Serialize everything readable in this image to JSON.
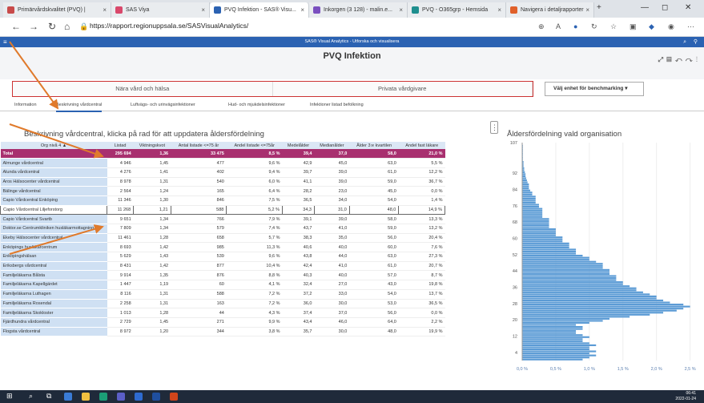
{
  "browser": {
    "tabs": [
      {
        "label": "Primärvårdskvalitet (PVQ) | ",
        "color": "#c84a4a"
      },
      {
        "label": "SAS Viya",
        "color": "#d9486b"
      },
      {
        "label": "PVQ Infektion - SAS® Visu...",
        "color": "#2b62b2"
      },
      {
        "label": "Inkorgen (3 128) - malin.e...",
        "color": "#7a4fbf"
      },
      {
        "label": "PVQ - O365grp - Hemsida",
        "color": "#1f8f8f"
      },
      {
        "label": "Navigera i detaljrapporter",
        "color": "#e0602a"
      }
    ],
    "url": "https://rapport.regionuppsala.se/SASVisualAnalytics/"
  },
  "sas": {
    "app_title": "SAS® Visual Analytics - Utforska och visualisera",
    "page_title": "PVQ Infektion",
    "segments": [
      "Nära vård och hälsa",
      "Privata vårdgivare"
    ],
    "benchmark_label": "Välj enhet för benchmarking ▾",
    "subtabs": [
      "Information",
      "Beskrivning vårdcentral",
      "Luftvägs- och urinvägsinfektioner",
      "Hud- och mjukdelsinfektioner",
      "Infektioner listad befolkning"
    ]
  },
  "table": {
    "caption": "Beskrivning vårdcentral, klicka på rad för att uppdatera åldersfördelning",
    "headers": [
      "Org nivå 4 ▲",
      "Listad",
      "Viktningskvot",
      "Antal listade <=75 år",
      "Andel listade <=75år",
      "Medelålder",
      "Medianålder",
      "Ålder 3:e kvartilen",
      "Andel fast läkare"
    ],
    "total": [
      "Total",
      "295 694",
      "1,36",
      "33 475",
      "8,5 %",
      "39,4",
      "37,0",
      "58,0",
      "21,0 %"
    ],
    "rows": [
      [
        "Almunge vårdcentral",
        "4 946",
        "1,45",
        "477",
        "9,6 %",
        "42,9",
        "45,0",
        "63,0",
        "5,5 %"
      ],
      [
        "Alunda vårdcentral",
        "4 276",
        "1,41",
        "402",
        "9,4 %",
        "39,7",
        "39,0",
        "61,0",
        "12,2 %"
      ],
      [
        "Aros Hälsocenter vårdcentral",
        "8 978",
        "1,31",
        "540",
        "6,0 %",
        "41,1",
        "39,0",
        "59,0",
        "36,7 %"
      ],
      [
        "Bälinge vårdcentral",
        "2 564",
        "1,24",
        "165",
        "6,4 %",
        "28,2",
        "23,0",
        "45,0",
        "0,0 %"
      ],
      [
        "Capio Vårdcentral Enköping",
        "11 346",
        "1,30",
        "846",
        "7,5 %",
        "36,5",
        "34,0",
        "54,0",
        "1,4 %"
      ],
      [
        "Capio Vårdcentral Liljeforstorg",
        "11 268",
        "1,21",
        "588",
        "5,2 %",
        "34,3",
        "31,0",
        "48,0",
        "14,9 %"
      ],
      [
        "Capio Vårdcentral Svartb",
        "9 651",
        "1,34",
        "766",
        "7,9 %",
        "39,1",
        "39,0",
        "58,0",
        "13,3 %"
      ],
      [
        "Doktor.se Centrumkliniken husläkarmottagning",
        "7 809",
        "1,34",
        "579",
        "7,4 %",
        "43,7",
        "41,0",
        "59,0",
        "13,2 %"
      ],
      [
        "Ekeby Hälsocenter vårdcentral",
        "11 461",
        "1,28",
        "658",
        "5,7 %",
        "38,3",
        "35,0",
        "56,0",
        "20,4 %"
      ],
      [
        "Enköpings husläkarcentrum",
        "8 693",
        "1,42",
        "985",
        "11,3 %",
        "40,6",
        "40,0",
        "60,0",
        "7,6 %"
      ],
      [
        "Enköpingshälsan",
        "5 629",
        "1,43",
        "539",
        "9,6 %",
        "43,8",
        "44,0",
        "63,0",
        "27,3 %"
      ],
      [
        "Eriksbergs vårdcentral",
        "8 431",
        "1,42",
        "877",
        "10,4 %",
        "42,4",
        "41,0",
        "61,0",
        "20,7 %"
      ],
      [
        "Familjeläkarna Bålsta",
        "9 914",
        "1,35",
        "876",
        "8,8 %",
        "40,3",
        "40,0",
        "57,0",
        "8,7 %"
      ],
      [
        "Familjeläkarna Kapellgärdet",
        "1 447",
        "1,19",
        "60",
        "4,1 %",
        "32,4",
        "27,0",
        "43,0",
        "19,8 %"
      ],
      [
        "Familjeläkarna Luthagen",
        "8 116",
        "1,31",
        "588",
        "7,2 %",
        "37,2",
        "33,0",
        "54,0",
        "13,7 %"
      ],
      [
        "Familjeläkarna Rosendal",
        "2 258",
        "1,31",
        "163",
        "7,2 %",
        "36,0",
        "30,0",
        "53,0",
        "36,5 %"
      ],
      [
        "Familjeläkarna Skokloster",
        "1 013",
        "1,28",
        "44",
        "4,3 %",
        "37,4",
        "37,0",
        "56,0",
        "0,0 %"
      ],
      [
        "Fjärdhundra vårdcentral",
        "2 729",
        "1,45",
        "271",
        "9,9 %",
        "43,4",
        "46,0",
        "64,0",
        "2,2 %"
      ],
      [
        "Flogsta vårdcentral",
        "8 972",
        "1,20",
        "344",
        "3,8 %",
        "35,7",
        "30,0",
        "48,0",
        "19,9 %"
      ]
    ],
    "selected_index": 5
  },
  "chart_data": {
    "type": "bar",
    "orientation": "horizontal",
    "title": "Åldersfördelning vald organisation",
    "y_ticks": [
      "107",
      "92",
      "84",
      "76",
      "68",
      "60",
      "52",
      "44",
      "36",
      "28",
      "20",
      "12",
      "4"
    ],
    "x_ticks": [
      "0,0 %",
      "0,5 %",
      "1,0 %",
      "1,5 %",
      "2,0 %",
      "2,5 %"
    ],
    "xlim": [
      0,
      2.6
    ],
    "ylim": [
      0,
      107
    ],
    "color": "#5b9bd5",
    "ages": [
      0,
      1,
      2,
      3,
      4,
      5,
      6,
      7,
      8,
      9,
      10,
      11,
      12,
      13,
      14,
      15,
      16,
      17,
      18,
      19,
      20,
      21,
      22,
      23,
      24,
      25,
      26,
      27,
      28,
      29,
      30,
      31,
      32,
      33,
      34,
      35,
      36,
      37,
      38,
      39,
      40,
      41,
      42,
      43,
      44,
      45,
      46,
      47,
      48,
      49,
      50,
      51,
      52,
      53,
      54,
      55,
      56,
      57,
      58,
      59,
      60,
      61,
      62,
      63,
      64,
      65,
      66,
      67,
      68,
      69,
      70,
      71,
      72,
      73,
      74,
      75,
      76,
      77,
      78,
      79,
      80,
      81,
      82,
      83,
      84,
      85,
      86,
      87,
      88,
      89,
      90,
      91,
      92,
      93,
      94,
      95,
      96,
      97,
      98,
      99,
      100,
      101,
      102,
      103,
      104,
      105
    ],
    "values": [
      0.9,
      1.0,
      1.1,
      1.0,
      1.1,
      1.0,
      1.0,
      1.1,
      1.0,
      0.9,
      0.9,
      1.0,
      0.9,
      0.8,
      0.8,
      0.9,
      0.9,
      0.8,
      1.0,
      1.2,
      1.3,
      1.6,
      1.9,
      2.1,
      2.3,
      2.4,
      2.5,
      2.4,
      2.2,
      2.1,
      2.0,
      2.0,
      1.9,
      1.8,
      1.7,
      1.7,
      1.6,
      1.5,
      1.5,
      1.4,
      1.4,
      1.4,
      1.3,
      1.3,
      1.3,
      1.2,
      1.2,
      1.2,
      1.1,
      1.0,
      1.0,
      0.9,
      0.8,
      0.8,
      0.8,
      0.7,
      0.7,
      0.7,
      0.6,
      0.6,
      0.6,
      0.5,
      0.5,
      0.5,
      0.5,
      0.4,
      0.4,
      0.4,
      0.4,
      0.4,
      0.3,
      0.3,
      0.3,
      0.3,
      0.3,
      0.25,
      0.25,
      0.2,
      0.2,
      0.2,
      0.2,
      0.15,
      0.15,
      0.12,
      0.1,
      0.1,
      0.1,
      0.08,
      0.07,
      0.06,
      0.05,
      0.05,
      0.04,
      0.03,
      0.03,
      0.02,
      0.02,
      0.02,
      0.01,
      0.01,
      0.01,
      0.01,
      0.01,
      0.01,
      0.01,
      0.01
    ]
  },
  "taskbar": {
    "time": "06:41",
    "date": "2022-01-24"
  }
}
